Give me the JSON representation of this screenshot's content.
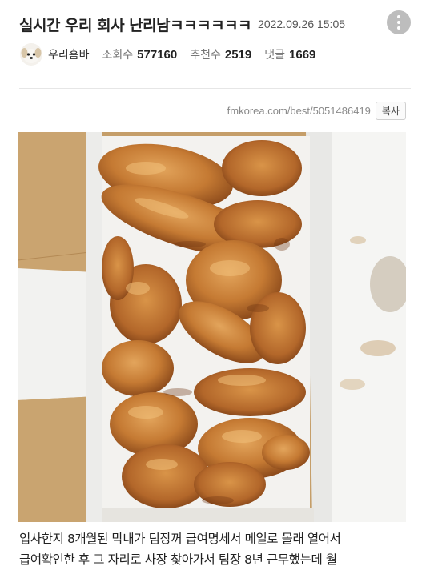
{
  "post": {
    "title": "실시간 우리 회사 난리남ㅋㅋㅋㅋㅋㅋ",
    "date": "2022.09.26 15:05",
    "author": "우리홈바",
    "views_label": "조회수",
    "views": "577160",
    "likes_label": "추천수",
    "likes": "2519",
    "comments_label": "댓글",
    "comments": "1669"
  },
  "source": {
    "url": "fmkorea.com/best/5051486419",
    "copy_label": "복사"
  },
  "body": {
    "line1": "입사한지 8개월된 막내가 팀장꺼 급여명세서 메일로 몰래 열어서",
    "line2": "급여확인한 후 그 자리로 사장 찾아가서 팀장 8년 근무했는데 월"
  },
  "icons": {
    "more": "more-vertical-icon",
    "avatar": "puppy-avatar"
  }
}
